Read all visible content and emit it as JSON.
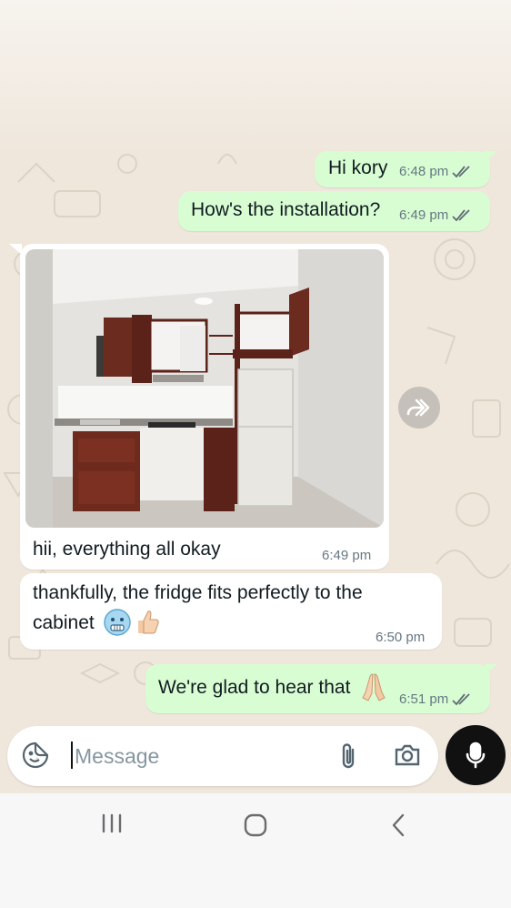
{
  "messages": [
    {
      "direction": "outgoing",
      "text": "Hi kory",
      "time": "6:48 pm",
      "status": "read"
    },
    {
      "direction": "outgoing",
      "text": "How's the installation?",
      "time": "6:49 pm",
      "status": "read"
    },
    {
      "direction": "incoming",
      "type": "image",
      "caption": "hii, everything all okay",
      "time": "6:49 pm"
    },
    {
      "direction": "incoming",
      "text_line1": "thankfully, the fridge fits perfectly to the",
      "text_line2": "cabinet",
      "emojis": [
        "cold-face",
        "thumbs-up"
      ],
      "time": "6:50 pm"
    },
    {
      "direction": "outgoing",
      "text": "We're glad to hear that",
      "emoji": "folded-hands",
      "time": "6:51 pm",
      "status": "read"
    }
  ],
  "composer": {
    "placeholder": "Message",
    "icons": [
      "sticker-icon",
      "attach-icon",
      "camera-icon",
      "mic-icon"
    ]
  },
  "navigation": [
    "recents-icon",
    "home-icon",
    "back-icon"
  ],
  "colors": {
    "outgoing_bubble": "#d9fdd3",
    "incoming_bubble": "#ffffff",
    "chat_background": "#efe7dc",
    "read_ticks": "#5f6b73"
  }
}
